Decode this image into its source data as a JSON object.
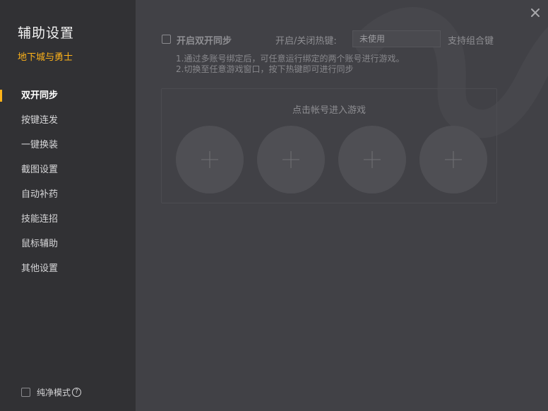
{
  "sidebar": {
    "title": "辅助设置",
    "game_name": "地下城与勇士",
    "items": [
      {
        "label": "双开同步"
      },
      {
        "label": "按键连发"
      },
      {
        "label": "一键换装"
      },
      {
        "label": "截图设置"
      },
      {
        "label": "自动补药"
      },
      {
        "label": "技能连招"
      },
      {
        "label": "鼠标辅助"
      },
      {
        "label": "其他设置"
      }
    ],
    "active_index": 0,
    "pure_mode_label": "纯净模式",
    "pure_mode_help": "?"
  },
  "main": {
    "sync_label": "开启双开同步",
    "hotkey_label": "开启/关闭热键:",
    "hotkey_value": "未使用",
    "combo_label": "支持组合键",
    "tips": [
      "1.通过多账号绑定后，可任意运行绑定的两个账号进行游戏。",
      "2.切换至任意游戏窗口，按下热键即可进行同步"
    ],
    "panel_title": "点击帐号进入游戏"
  },
  "colors": {
    "accent": "#ffb319",
    "sidebar_bg": "#313134",
    "content_bg": "#414146"
  },
  "icons": {
    "close": "close-icon",
    "add": "plus-icon",
    "help": "question-circle-icon"
  }
}
